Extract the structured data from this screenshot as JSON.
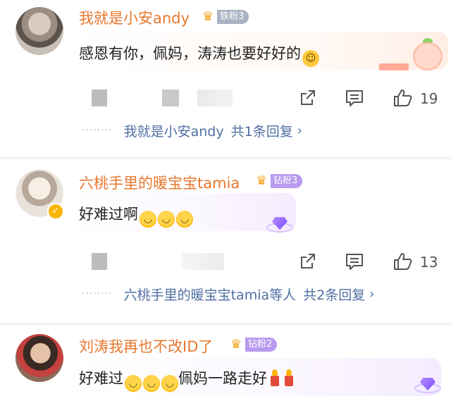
{
  "comments": [
    {
      "username": "我就是小安andy",
      "fan_badge": "铁粉3",
      "text_main": "感恩有你，佩妈，涛涛也要好好的",
      "emoji": "hug-emoji",
      "like_count": "19",
      "reply_user": "我就是小安andy",
      "reply_count": "共1条回复"
    },
    {
      "username": "六桃手里的暖宝宝tamia",
      "fan_badge": "钻粉3",
      "text_main": "好难过啊",
      "emoji": "crying-emoji",
      "like_count": "13",
      "reply_user": "六桃手里的暖宝宝tamia等人",
      "reply_count": "共2条回复"
    },
    {
      "username": "刘涛我再也不改ID了",
      "fan_badge": "钻粉2",
      "text_pre": "好难过",
      "text_post": "佩妈一路走好",
      "emoji": "crying-emoji"
    }
  ],
  "icons": {
    "share": "share-icon",
    "comment": "comment-icon",
    "like": "thumbs-up-icon",
    "verified": "verified-icon"
  },
  "colors": {
    "username": "#e8772e",
    "reply_link": "#4f6fa3",
    "iron_fan_badge": "#a8b3c4",
    "diamond_fan_badge": "#b89aee"
  }
}
